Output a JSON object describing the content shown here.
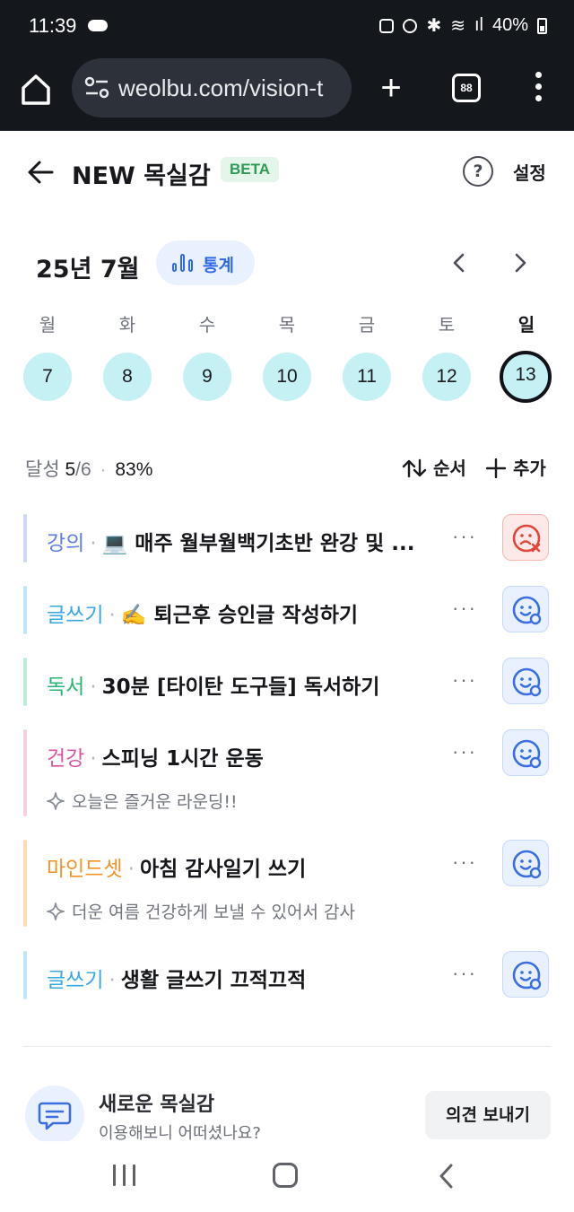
{
  "status_bar": {
    "time": "11:39",
    "battery": "40%"
  },
  "browser": {
    "url": "weolbu.com/vision-t",
    "tab_count": "88"
  },
  "header": {
    "title": "NEW 목실감",
    "badge": "BETA",
    "help": "?",
    "settings": "설정"
  },
  "calendar": {
    "month_label": "25년 7월",
    "stats_label": "통계",
    "weekdays": [
      "월",
      "화",
      "수",
      "목",
      "금",
      "토",
      "일"
    ],
    "days": [
      "7",
      "8",
      "9",
      "10",
      "11",
      "12",
      "13"
    ],
    "selected_day": "13"
  },
  "summary": {
    "label": "달성",
    "done": "5",
    "total": "/6",
    "percent": "83%",
    "order_label": "순서",
    "add_label": "추가"
  },
  "tasks": [
    {
      "category": "강의",
      "name": "💻 매주 월부월백기초반 완강 및 ...",
      "status": "bad",
      "memo": ""
    },
    {
      "category": "글쓰기",
      "name": "✍️ 퇴근후 승인글 작성하기",
      "status": "good",
      "memo": ""
    },
    {
      "category": "독서",
      "name": "30분 [타이탄 도구들] 독서하기",
      "status": "good",
      "memo": ""
    },
    {
      "category": "건강",
      "name": "스피닝 1시간 운동",
      "status": "good",
      "memo": "오늘은 즐거운 라운딩!!"
    },
    {
      "category": "마인드셋",
      "name": "아침 감사일기 쓰기",
      "status": "good",
      "memo": "더운 여름 건강하게 보낼 수 있어서 감사"
    },
    {
      "category": "글쓰기",
      "name": "생활 글쓰기 끄적끄적",
      "status": "good",
      "memo": ""
    }
  ],
  "category_colors": {
    "강의": "#5f7ee8",
    "글쓰기": "#3aa8e0",
    "독서": "#27b673",
    "건강": "#d9559c",
    "마인드셋": "#f0942a"
  },
  "category_bar_colors": {
    "강의": "#cfd8f7",
    "글쓰기": "#bfe6f6",
    "독서": "#bdeed5",
    "건강": "#f6cde2",
    "마인드셋": "#fbdcb4"
  },
  "feedback": {
    "title": "새로운 목실감",
    "subtitle": "이용해보니 어떠셨나요?",
    "button": "의견 보내기"
  }
}
